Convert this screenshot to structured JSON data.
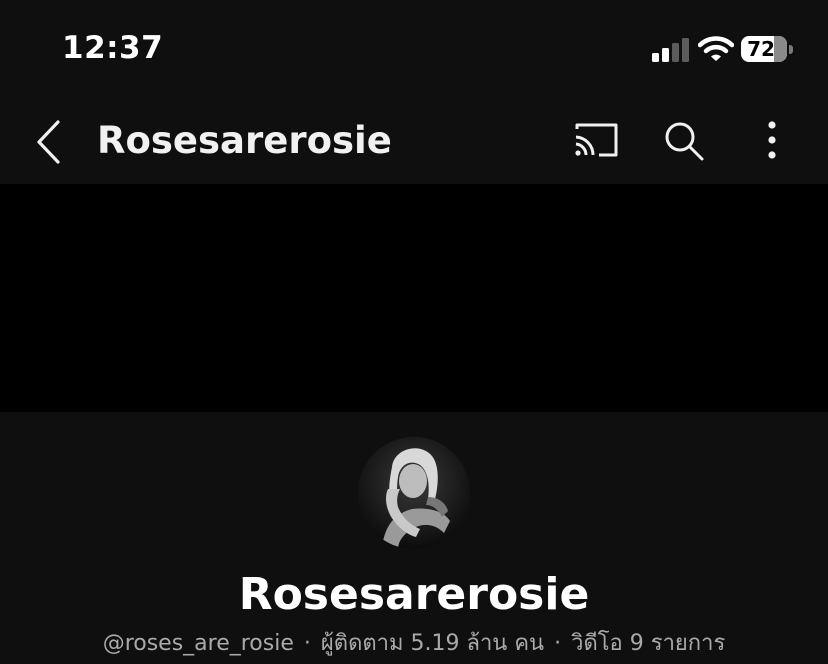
{
  "status_bar": {
    "time": "12:37",
    "battery_level": "72",
    "battery_fraction": 0.72,
    "signal_bars_active": 2,
    "signal_bars_total": 4
  },
  "app_bar": {
    "title": "Rosesarerosie",
    "icons": [
      "back-icon",
      "cast-icon",
      "search-icon",
      "more-vertical-icon"
    ]
  },
  "channel": {
    "name": "Rosesarerosie",
    "handle": "@roses_are_rosie",
    "separator": "·",
    "subscribers": "ผู้ติดตาม 5.19 ล้าน คน",
    "videos": "วิดีโอ 9 รายการ"
  },
  "colors": {
    "background": "#0f0f0f",
    "banner": "#000000",
    "text_primary": "#f1f1f1",
    "text_secondary": "#aaaaaa"
  }
}
